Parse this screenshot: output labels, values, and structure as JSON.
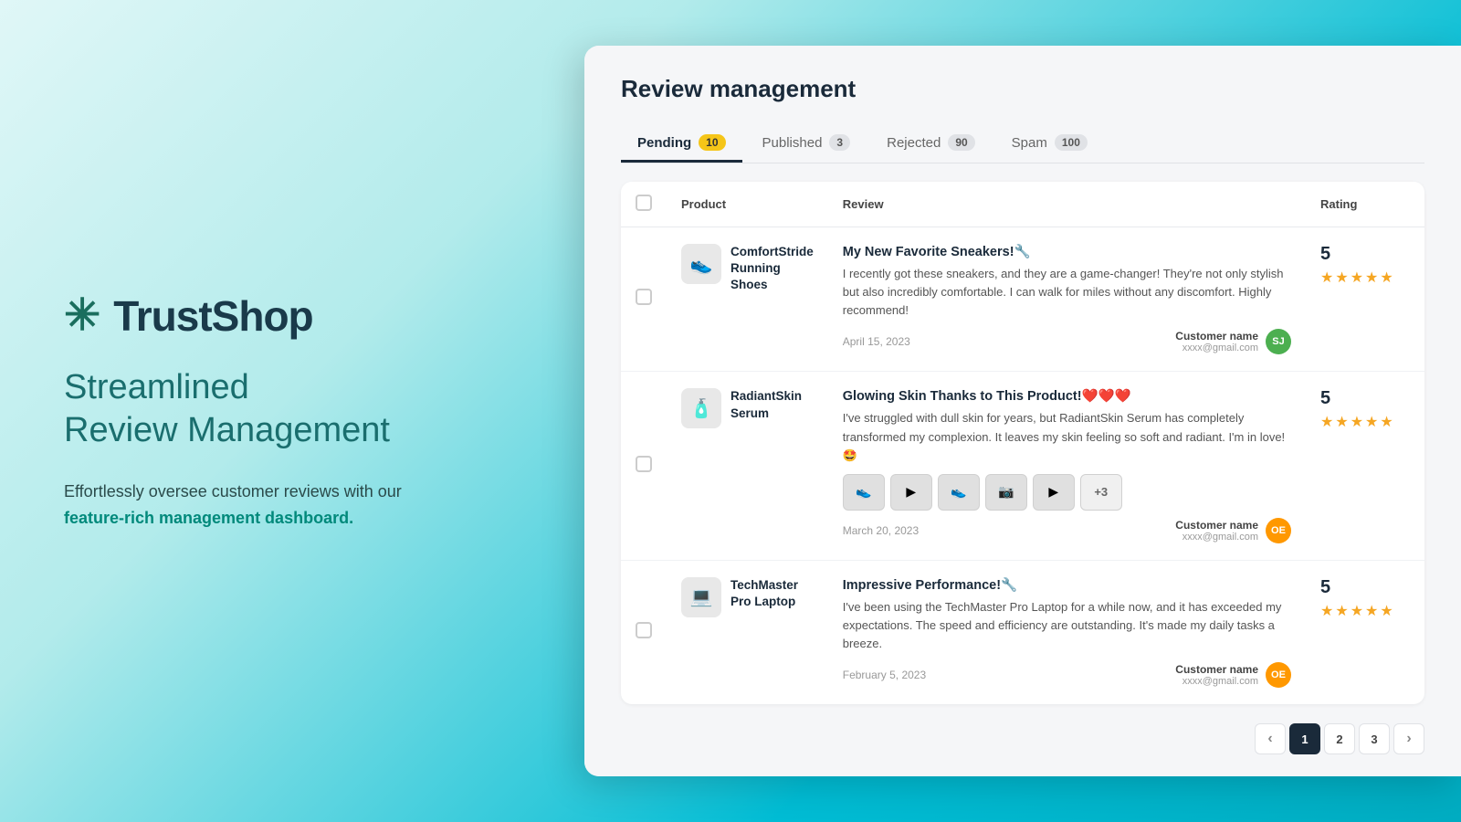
{
  "brand": {
    "logo_icon": "✳",
    "name": "TrustShop",
    "tagline": "Streamlined\nReview Management",
    "description": "Effortlessly oversee customer reviews with our ",
    "description_highlight": "feature-rich management dashboard.",
    "logo_img_alt": "TrustShop Logo"
  },
  "app": {
    "title": "Review management",
    "tabs": [
      {
        "id": "pending",
        "label": "Pending",
        "badge": "10",
        "badge_style": "yellow",
        "active": true
      },
      {
        "id": "published",
        "label": "Published",
        "badge": "3",
        "badge_style": "gray",
        "active": false
      },
      {
        "id": "rejected",
        "label": "Rejected",
        "badge": "90",
        "badge_style": "gray",
        "active": false
      },
      {
        "id": "spam",
        "label": "Spam",
        "badge": "100",
        "badge_style": "gray",
        "active": false
      }
    ],
    "table": {
      "columns": [
        "",
        "Product",
        "Review",
        "Rating"
      ],
      "rows": [
        {
          "id": "row-1",
          "product_icon": "👟",
          "product_name": "ComfortStride\nRunning Shoes",
          "review_title": "My New Favorite Sneakers!🔧",
          "review_text": "I recently got these sneakers, and they are a game-changer! They're not only stylish but also incredibly comfortable. I can walk for miles without any discomfort. Highly recommend!",
          "date": "April 15, 2023",
          "customer_name": "Customer name",
          "customer_email": "xxxx@gmail.com",
          "avatar_initials": "SJ",
          "avatar_style": "avatar-green",
          "rating": 5,
          "has_media": false
        },
        {
          "id": "row-2",
          "product_icon": "🧴",
          "product_name": "RadiantSkin\nSerum",
          "review_title": "Glowing Skin Thanks to This Product!❤️❤️❤️",
          "review_text": "I've struggled with dull skin for years, but RadiantSkin Serum has completely transformed my complexion. It leaves my skin feeling so soft and radiant. I'm in love! 🤩",
          "date": "March 20, 2023",
          "customer_name": "Customer name",
          "customer_email": "xxxx@gmail.com",
          "avatar_initials": "OE",
          "avatar_style": "avatar-orange",
          "rating": 5,
          "has_media": true,
          "media_count": 5,
          "media_extra": "+3"
        },
        {
          "id": "row-3",
          "product_icon": "💻",
          "product_name": "TechMaster\nPro Laptop",
          "review_title": "Impressive Performance!🔧",
          "review_text": "I've been using the TechMaster Pro Laptop for a while now, and it has exceeded my expectations. The speed and efficiency are outstanding. It's made my daily tasks a breeze.",
          "date": "February 5, 2023",
          "customer_name": "Customer name",
          "customer_email": "xxxx@gmail.com",
          "avatar_initials": "OE",
          "avatar_style": "avatar-orange",
          "rating": 5,
          "has_media": false
        }
      ]
    },
    "pagination": {
      "prev_label": "‹",
      "next_label": "›",
      "pages": [
        1,
        2,
        3
      ],
      "active_page": 1
    }
  }
}
